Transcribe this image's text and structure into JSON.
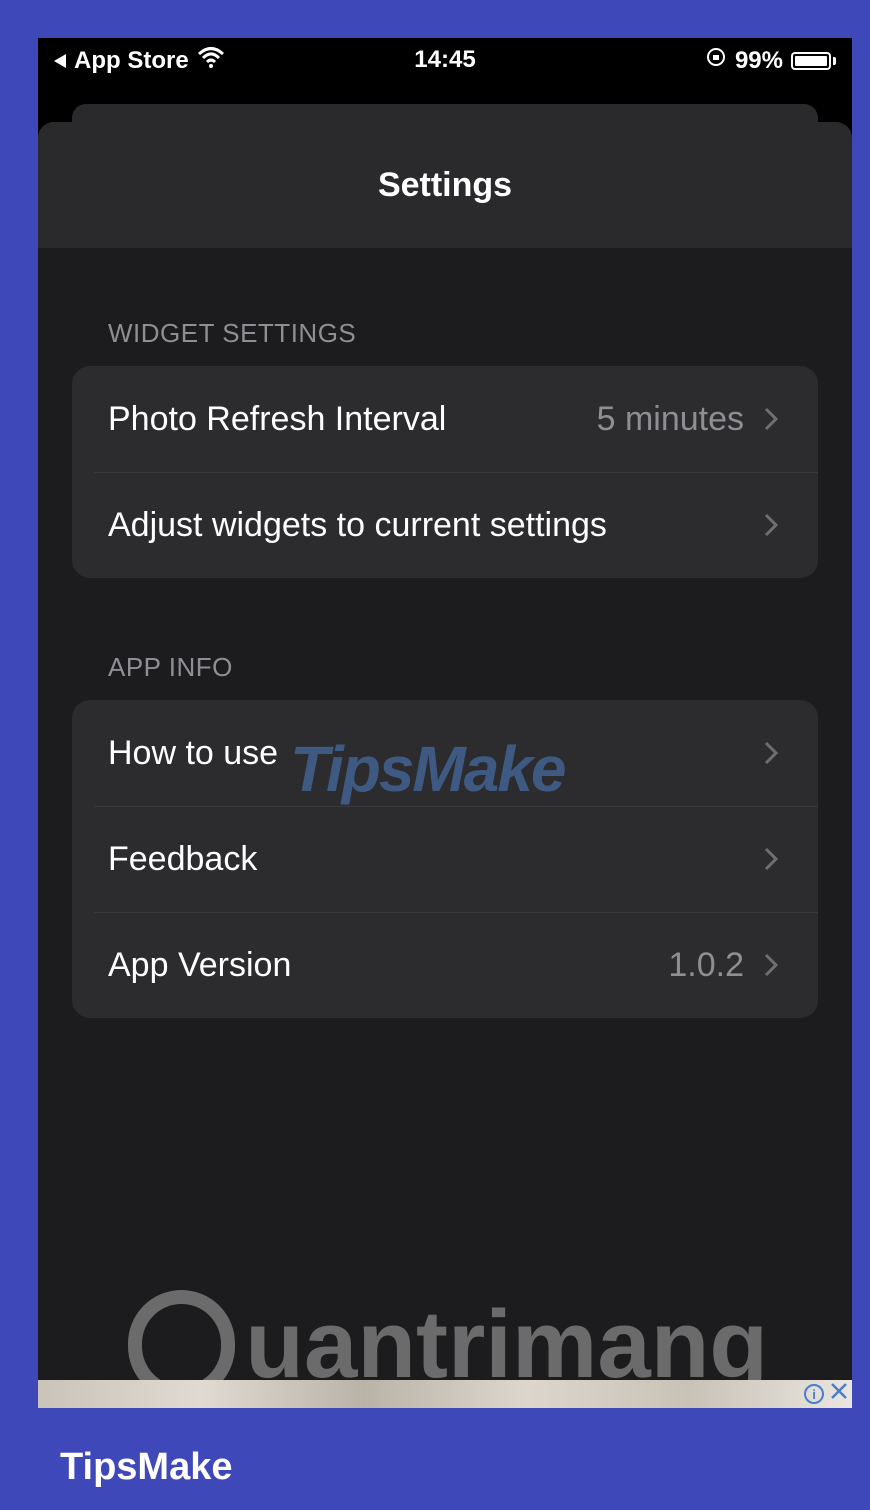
{
  "status_bar": {
    "back_app": "App Store",
    "time": "14:45",
    "battery": "99%",
    "battery_fraction": 0.99
  },
  "nav": {
    "title": "Settings"
  },
  "sections": [
    {
      "header": "WIDGET SETTINGS",
      "rows": [
        {
          "label": "Photo Refresh Interval",
          "value": "5 minutes"
        },
        {
          "label": "Adjust widgets to current settings",
          "value": ""
        }
      ]
    },
    {
      "header": "APP INFO",
      "rows": [
        {
          "label": "How to use",
          "value": ""
        },
        {
          "label": "Feedback",
          "value": ""
        },
        {
          "label": "App Version",
          "value": "1.0.2"
        }
      ]
    }
  ],
  "watermarks": {
    "tipsmake": "TipsMake",
    "quantrimang": "uantrimang"
  },
  "footer": {
    "brand": "TipsMake"
  },
  "colors": {
    "frame": "#3f48b8",
    "background": "#1c1c1e",
    "group": "#2c2c2e",
    "secondary_text": "#8e8e93"
  },
  "icons": [
    "back-triangle-icon",
    "wifi-icon",
    "orientation-lock-icon",
    "battery-icon",
    "chevron-right-icon",
    "ad-info-icon",
    "ad-close-icon"
  ]
}
